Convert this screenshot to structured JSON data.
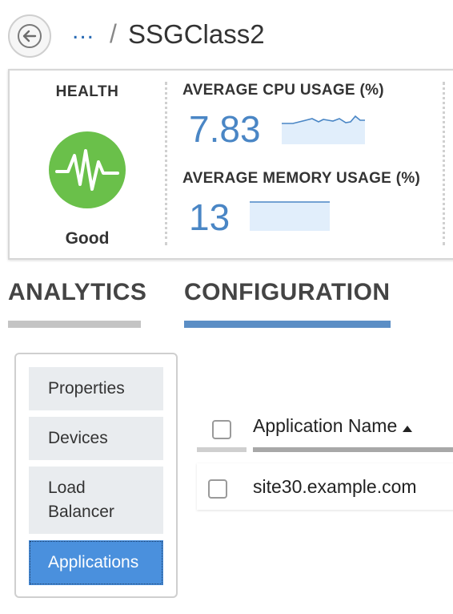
{
  "header": {
    "breadcrumb_ellipsis": "...",
    "breadcrumb_separator": "/",
    "title": "SSGClass2"
  },
  "summary": {
    "health": {
      "title": "HEALTH",
      "status": "Good",
      "status_color": "#6ac04a"
    },
    "cpu": {
      "label": "AVERAGE CPU USAGE (%)",
      "value": "7.83"
    },
    "memory": {
      "label": "AVERAGE MEMORY USAGE (%)",
      "value": "13"
    },
    "accent_color": "#4a86c5"
  },
  "tabs": [
    {
      "label": "ANALYTICS",
      "active": false
    },
    {
      "label": "CONFIGURATION",
      "active": true
    }
  ],
  "sidenav": {
    "items": [
      {
        "label": "Properties",
        "selected": false
      },
      {
        "label": "Devices",
        "selected": false
      },
      {
        "label": "Load Balancer",
        "selected": false
      },
      {
        "label": "Applications",
        "selected": true
      }
    ]
  },
  "table": {
    "columns": [
      {
        "label": "Application Name",
        "sort": "ascending"
      }
    ],
    "rows": [
      {
        "name": "site30.example.com",
        "checked": false
      }
    ]
  },
  "icons": {
    "back": "back-arrow-icon",
    "health": "heartbeat-icon",
    "sort": "sort-ascending-icon"
  }
}
